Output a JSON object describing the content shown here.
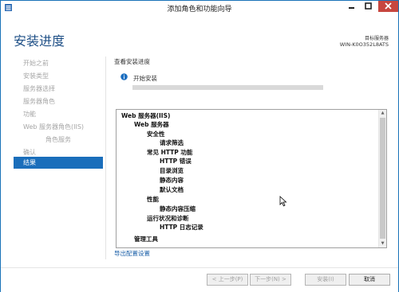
{
  "window": {
    "title": "添加角色和功能向导",
    "minimize_label": "—",
    "maximize_label": "▢",
    "close_label": "✕"
  },
  "header": {
    "page_title": "安装进度",
    "server_label": "目标服务器",
    "server_name": "WIN-K0O352L8ATS"
  },
  "sidebar": {
    "items": [
      {
        "label": "开始之前"
      },
      {
        "label": "安装类型"
      },
      {
        "label": "服务器选择"
      },
      {
        "label": "服务器角色"
      },
      {
        "label": "功能"
      },
      {
        "label": "Web 服务器角色(IIS)"
      },
      {
        "label": "角色服务"
      },
      {
        "label": "确认"
      },
      {
        "label": "结果"
      }
    ],
    "active_index": 8
  },
  "main": {
    "section_label": "查看安装进度",
    "status_text": "开始安装",
    "progress_percent": 0,
    "results": [
      {
        "label": "Web 服务器(IIS)"
      },
      {
        "label": "Web 服务器"
      },
      {
        "label": "安全性"
      },
      {
        "label": "请求筛选"
      },
      {
        "label": "常见 HTTP 功能"
      },
      {
        "label": "HTTP 错误"
      },
      {
        "label": "目录浏览"
      },
      {
        "label": "静态内容"
      },
      {
        "label": "默认文档"
      },
      {
        "label": "性能"
      },
      {
        "label": "静态内容压缩"
      },
      {
        "label": "运行状况和诊断"
      },
      {
        "label": "HTTP 日志记录"
      },
      {
        "label": "管理工具"
      }
    ],
    "export_link": "导出配置设置"
  },
  "footer": {
    "prev_label": "< 上一步(P)",
    "next_label": "下一步(N) >",
    "install_label": "安装(I)",
    "cancel_label": "取消"
  },
  "colors": {
    "accent": "#1a6ebb",
    "title_text": "#1e4f86",
    "close_button": "#c7463f",
    "link": "#1a5fa8"
  }
}
